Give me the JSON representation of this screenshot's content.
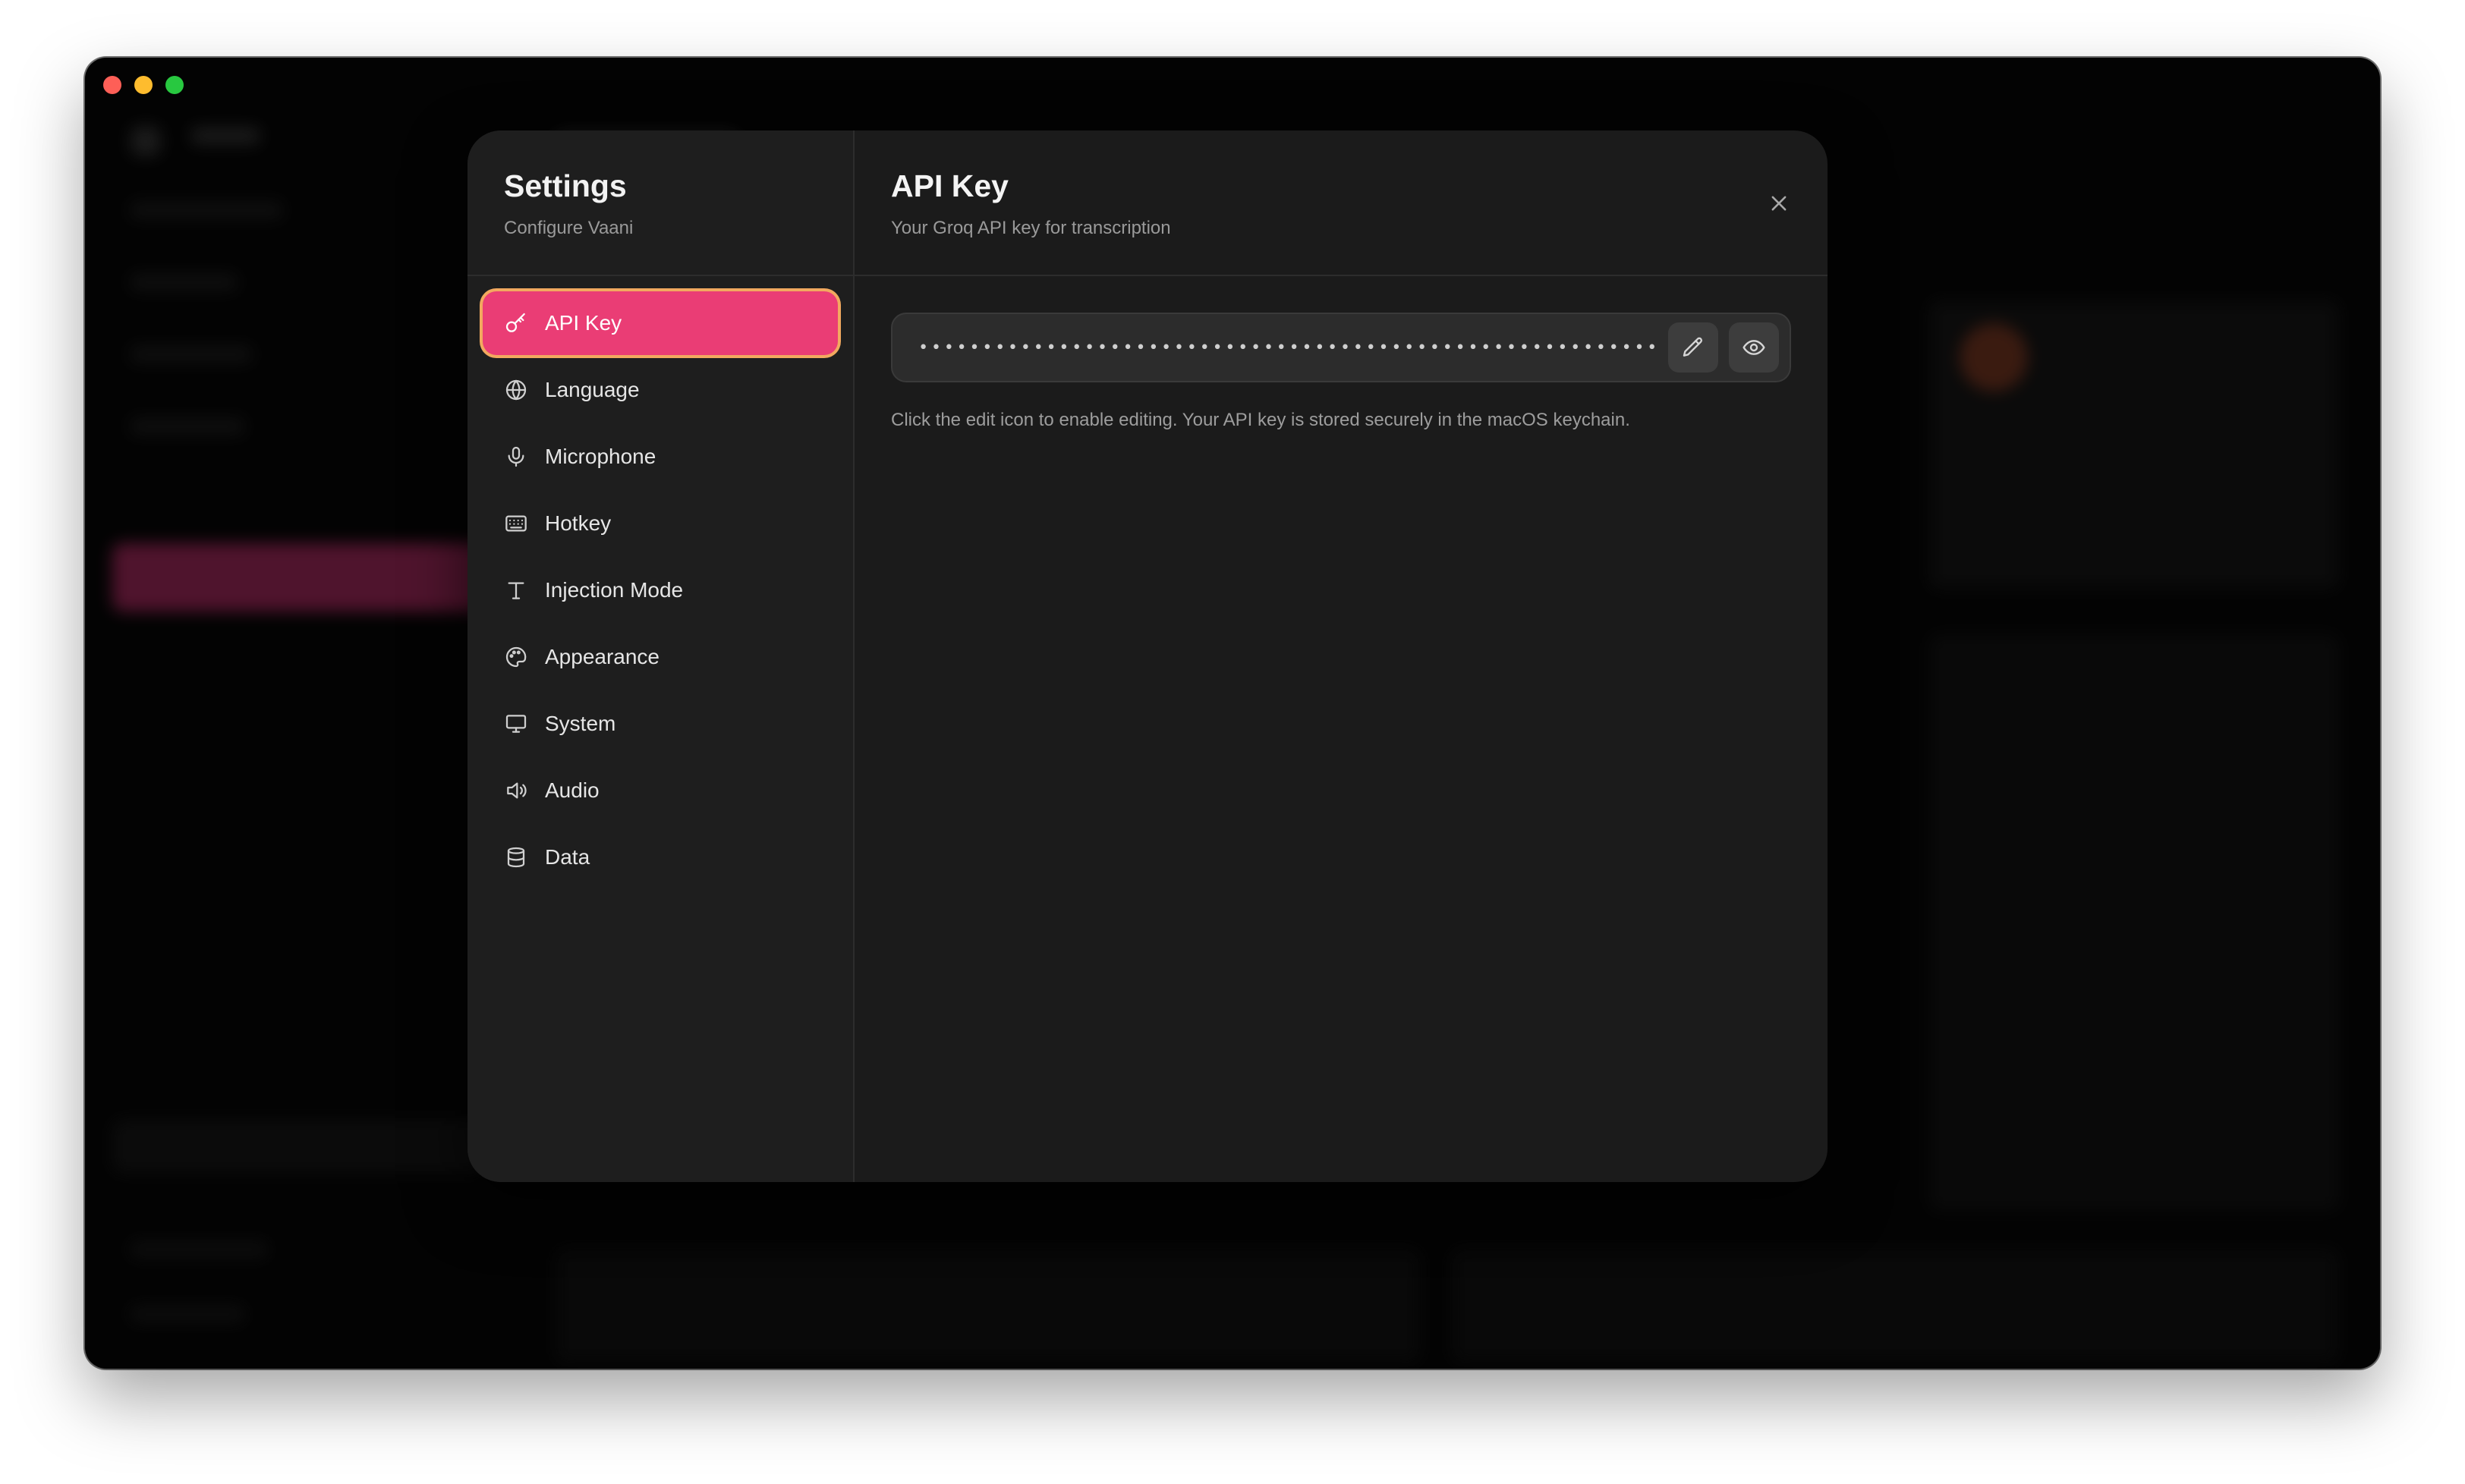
{
  "settings": {
    "title": "Settings",
    "subtitle": "Configure Vaani"
  },
  "nav": [
    {
      "label": "API Key",
      "icon": "key-icon",
      "active": true
    },
    {
      "label": "Language",
      "icon": "globe-icon"
    },
    {
      "label": "Microphone",
      "icon": "microphone-icon"
    },
    {
      "label": "Hotkey",
      "icon": "keyboard-icon"
    },
    {
      "label": "Injection Mode",
      "icon": "text-icon"
    },
    {
      "label": "Appearance",
      "icon": "palette-icon"
    },
    {
      "label": "System",
      "icon": "monitor-icon"
    },
    {
      "label": "Audio",
      "icon": "speaker-icon"
    },
    {
      "label": "Data",
      "icon": "database-icon"
    }
  ],
  "panel": {
    "title": "API Key",
    "subtitle": "Your Groq API key for transcription",
    "key_masked": "••••••••••••••••••••••••••••••••••••••••••••••••••••••••••",
    "helper": "Click the edit icon to enable editing. Your API key is stored securely in the macOS keychain."
  },
  "colors": {
    "accent": "#ea3d75",
    "active_outline": "#f2a95f",
    "modal_bg": "#1b1b1b"
  }
}
